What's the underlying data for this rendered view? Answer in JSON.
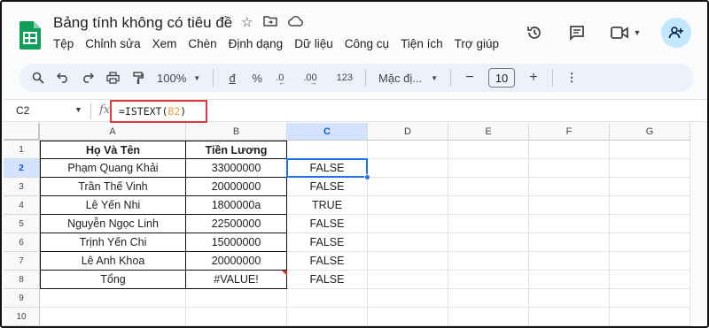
{
  "app": {
    "title": "Bảng tính không có tiêu đề",
    "title_icons": [
      "star-icon",
      "move-to-folder-icon",
      "cloud-saved-icon"
    ],
    "menu": [
      "Tệp",
      "Chỉnh sửa",
      "Xem",
      "Chèn",
      "Định dạng",
      "Dữ liệu",
      "Công cụ",
      "Tiện ích",
      "Trợ giúp"
    ],
    "right_icons": [
      "history-icon",
      "comments-icon",
      "meet-icon",
      "share-icon"
    ],
    "colors": {
      "accent": "#1a73e8",
      "logo_green": "#0f9d58",
      "highlight_red": "#e03a3a",
      "toolbar_bg": "#edf2fa"
    }
  },
  "toolbar": {
    "zoom": "100%",
    "currency": "đ",
    "percent": "%",
    "dec_decrease": ".0",
    "dec_increase": ".00",
    "number_format": "123",
    "font": "Mặc đị...",
    "font_size": "10",
    "minus": "−",
    "plus": "+"
  },
  "formula_bar": {
    "name_box": "C2",
    "fx": "fx",
    "formula_prefix": "=ISTEXT(",
    "formula_ref": "B2",
    "formula_suffix": ")"
  },
  "grid": {
    "columns": [
      "A",
      "B",
      "C",
      "D",
      "E",
      "F",
      "G"
    ],
    "rows": [
      "1",
      "2",
      "3",
      "4",
      "5",
      "6",
      "7",
      "8",
      "9",
      "10"
    ],
    "headers": {
      "a": "Họ Và Tên",
      "b": "Tiền Lương"
    },
    "data": [
      {
        "a": "Phạm Quang Khải",
        "b": "33000000",
        "c": "FALSE"
      },
      {
        "a": "Trần Thế Vinh",
        "b": "20000000",
        "c": "FALSE"
      },
      {
        "a": "Lê Yến Nhi",
        "b": "1800000a",
        "c": "TRUE"
      },
      {
        "a": "Nguyễn Ngọc Linh",
        "b": "22500000",
        "c": "FALSE"
      },
      {
        "a": "Trịnh Yến Chi",
        "b": "15000000",
        "c": "FALSE"
      },
      {
        "a": "Lê Anh Khoa",
        "b": "20000000",
        "c": "FALSE"
      },
      {
        "a": "Tổng",
        "b": "#VALUE!",
        "c": "FALSE"
      }
    ],
    "selected_cell": "C2"
  }
}
